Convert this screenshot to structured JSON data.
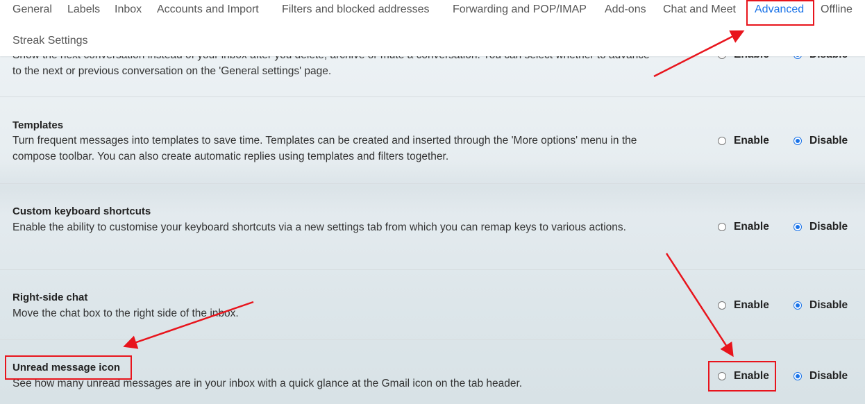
{
  "tabs": [
    "General",
    "Labels",
    "Inbox",
    "Accounts and Import",
    "Filters and blocked addresses",
    "Forwarding and POP/IMAP",
    "Add-ons",
    "Chat and Meet",
    "Advanced",
    "Offline"
  ],
  "active_tab": "Advanced",
  "streak": "Streak Settings",
  "radio_labels": {
    "enable": "Enable",
    "disable": "Disable"
  },
  "sections": [
    {
      "title": "",
      "desc": "Show the next conversation instead of your inbox after you delete, archive or mute a conversation. You can select whether to advance to the next or previous conversation on the 'General settings' page.",
      "selected": "Disable"
    },
    {
      "title": "Templates",
      "desc": "Turn frequent messages into templates to save time. Templates can be created and inserted through the 'More options' menu in the compose toolbar. You can also create automatic replies using templates and filters together.",
      "selected": "Disable"
    },
    {
      "title": "Custom keyboard shortcuts",
      "desc": "Enable the ability to customise your keyboard shortcuts via a new settings tab from which you can remap keys to various actions.",
      "selected": "Disable"
    },
    {
      "title": "Right-side chat",
      "desc": "Move the chat box to the right side of the inbox.",
      "selected": "Disable"
    },
    {
      "title": "Unread message icon",
      "desc": "See how many unread messages are in your inbox with a quick glance at the Gmail icon on the tab header.",
      "selected": "Disable"
    }
  ],
  "annotation_color": "#e8141c",
  "accent": "#1a73e8"
}
